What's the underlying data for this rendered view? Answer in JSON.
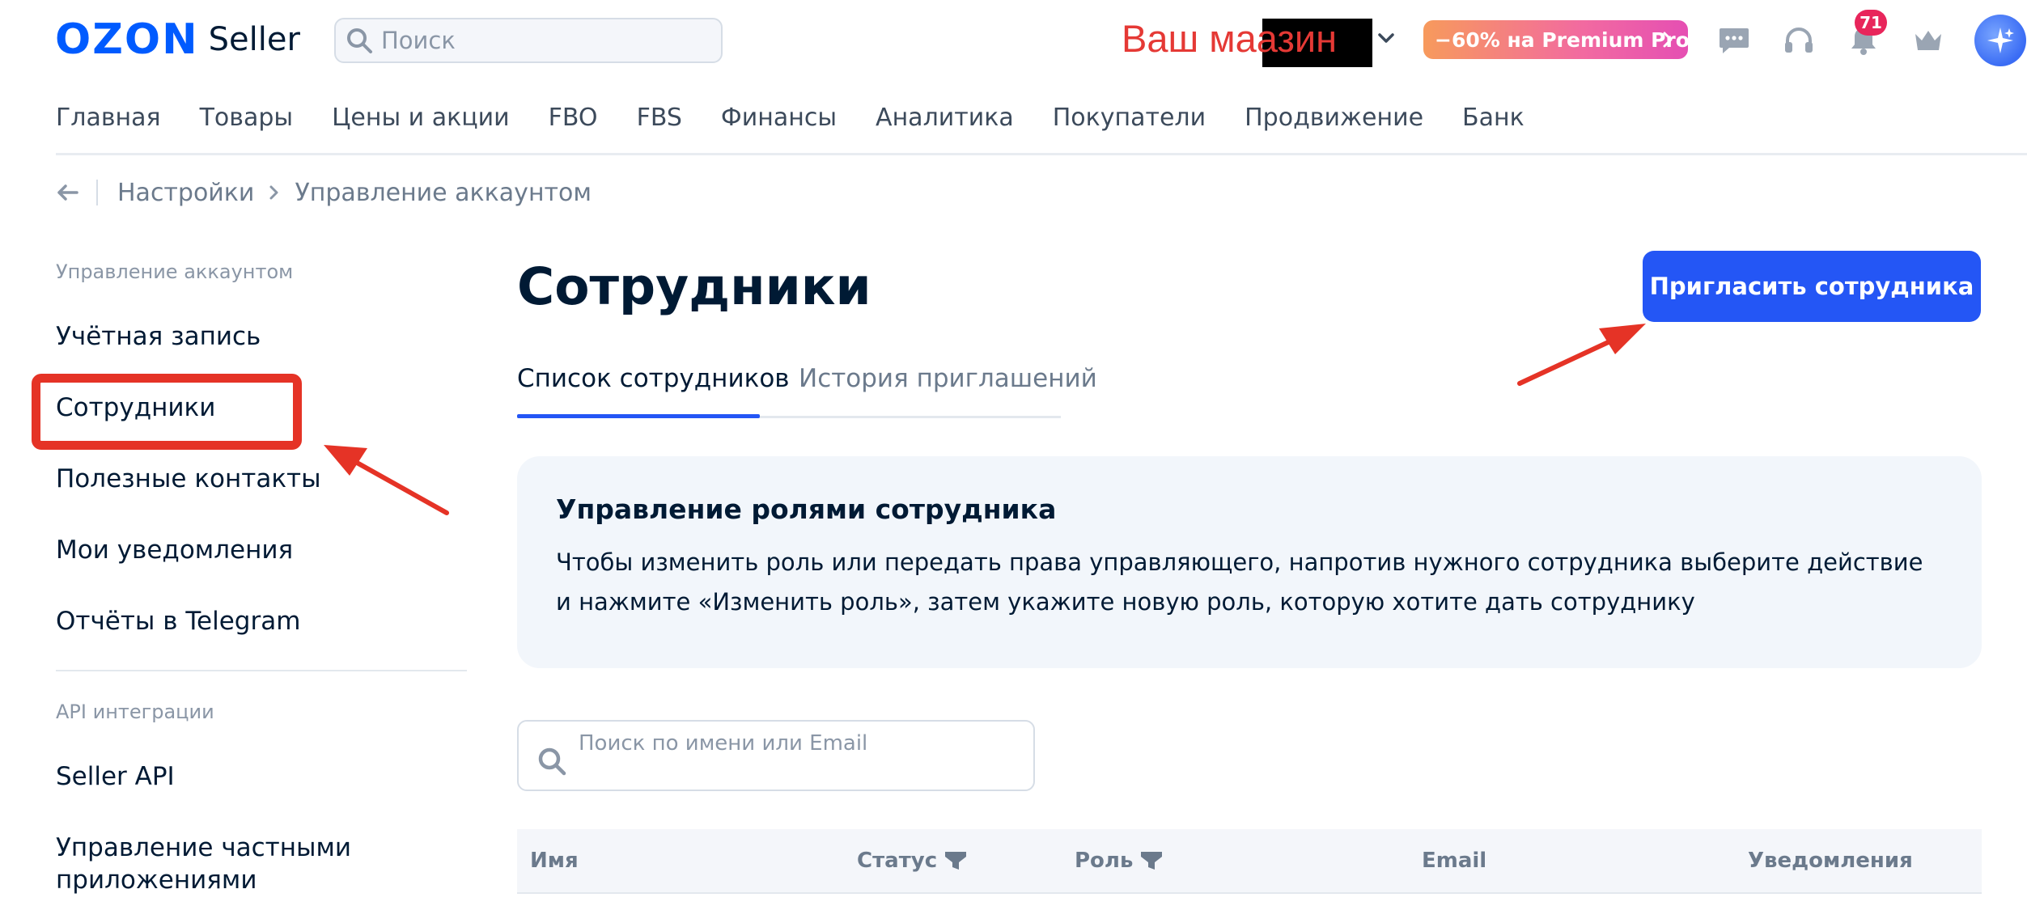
{
  "header": {
    "logo_brand": "OZON",
    "logo_product": "Seller",
    "search_placeholder": "Поиск",
    "store_name_visible_left": "Ваш ма",
    "store_name_visible_right": "азин",
    "promo_label": "−60% на Premium Pro",
    "notifications_count": "71",
    "icons": [
      "search-icon",
      "chevron-down-icon",
      "chat-icon",
      "headset-icon",
      "bell-icon",
      "crown-icon",
      "sparkle-icon"
    ],
    "accent_color": "#005bff"
  },
  "nav": {
    "items": [
      "Главная",
      "Товары",
      "Цены и акции",
      "FBO",
      "FBS",
      "Финансы",
      "Аналитика",
      "Покупатели",
      "Продвижение",
      "Банк"
    ]
  },
  "breadcrumb": {
    "items": [
      "Настройки",
      "Управление аккаунтом"
    ]
  },
  "sidebar": {
    "section1_label": "Управление аккаунтом",
    "items": [
      "Учётная запись",
      "Сотрудники",
      "Полезные контакты",
      "Мои уведомления",
      "Отчёты в Telegram"
    ],
    "section2_label": "API интеграции",
    "api_items": [
      "Seller API",
      "Управление частными",
      "приложениями"
    ],
    "highlighted_item": "Сотрудники",
    "highlight_color": "#e53326"
  },
  "main": {
    "title": "Сотрудники",
    "invite_button": "Пригласить сотрудника",
    "tabs": [
      "Список сотрудников",
      "История приглашений"
    ],
    "active_tab": "Список сотрудников",
    "info": {
      "title": "Управление ролями сотрудника",
      "line1": "Чтобы изменить роль или передать права управляющего, напротив нужного сотрудника выберите действие",
      "line2": "и нажмите «Изменить роль», затем укажите новую роль, которую хотите дать сотруднику"
    },
    "employee_search_placeholder": "Поиск по имени или Email",
    "table_headers": [
      "Имя",
      "Статус",
      "Роль",
      "Email",
      "Уведомления"
    ],
    "button_color": "#2456f5"
  },
  "annotations": {
    "arrow_color": "#e53326"
  }
}
